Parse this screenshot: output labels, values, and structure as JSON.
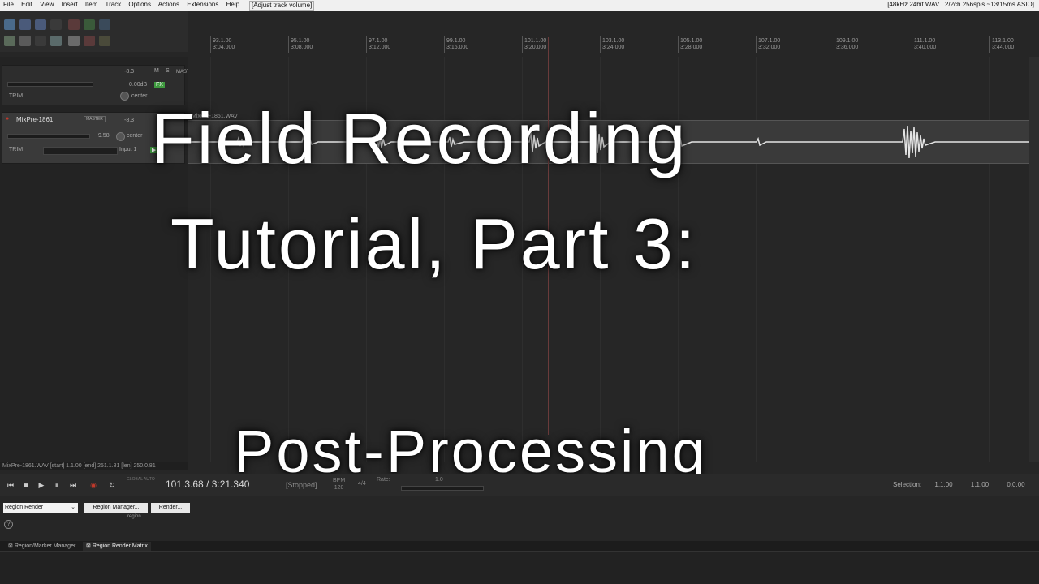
{
  "menubar": {
    "items": [
      "File",
      "Edit",
      "View",
      "Insert",
      "Item",
      "Track",
      "Options",
      "Actions",
      "Extensions",
      "Help"
    ],
    "status": "[Adjust track volume]",
    "audio_info": "[48kHz 24bit WAV : 2/2ch 256spls ~13/15ms ASIO]"
  },
  "ruler": {
    "marks": [
      {
        "bar": "93.1.00",
        "time": "3:04.000"
      },
      {
        "bar": "95.1.00",
        "time": "3:08.000"
      },
      {
        "bar": "97.1.00",
        "time": "3:12.000"
      },
      {
        "bar": "99.1.00",
        "time": "3:16.000"
      },
      {
        "bar": "101.1.00",
        "time": "3:20.000"
      },
      {
        "bar": "103.1.00",
        "time": "3:24.000"
      },
      {
        "bar": "105.1.00",
        "time": "3:28.000"
      },
      {
        "bar": "107.1.00",
        "time": "3:32.000"
      },
      {
        "bar": "109.1.00",
        "time": "3:36.000"
      },
      {
        "bar": "111.1.00",
        "time": "3:40.000"
      },
      {
        "bar": "113.1.00",
        "time": "3:44.000"
      }
    ]
  },
  "master": {
    "label": "MASTER",
    "volume": "0.00dB",
    "pan": "center",
    "trim": "TRIM",
    "meter": "-8.3",
    "m": "M",
    "s": "S",
    "fx": "FX"
  },
  "track": {
    "name": "MixPre-1861",
    "master_btn": "MASTER",
    "meter": "-8.3",
    "volume": "9.58",
    "pan": "center",
    "input": "Input 1",
    "trim": "TRIM",
    "item_name": "MixPre-1861.WAV"
  },
  "overlay": {
    "line1": "Field Recording",
    "line2": "Tutorial, Part 3:",
    "subtitle": "Post-Processing"
  },
  "info_line": "MixPre-1861.WAV [start] 1.1.00 [end] 251.1.81 [len] 250.0.81",
  "transport": {
    "time": "101.3.68 / 3:21.340",
    "state": "[Stopped]",
    "bpm_label": "BPM",
    "bpm": "120",
    "timesig": "4/4",
    "rate_label": "Rate:",
    "rate_value": "1.0",
    "global_auto": "GLOBAL AUTO",
    "selection_label": "Selection:",
    "sel_start": "1.1.00",
    "sel_end": "1.1.00",
    "sel_len": "0.0.00"
  },
  "docker": {
    "dropdown": "Region Render",
    "region_manager_btn": "Region Manager...",
    "render_btn": "Render...",
    "region_label": "region",
    "help": "?"
  },
  "tabs": [
    {
      "label": "Region/Marker Manager",
      "active": false
    },
    {
      "label": "Region Render Matrix",
      "active": true
    }
  ],
  "colors": {
    "fx_green": "#3f9a3f",
    "record": "#c0392b",
    "play_cursor": "#6a3b3b"
  }
}
